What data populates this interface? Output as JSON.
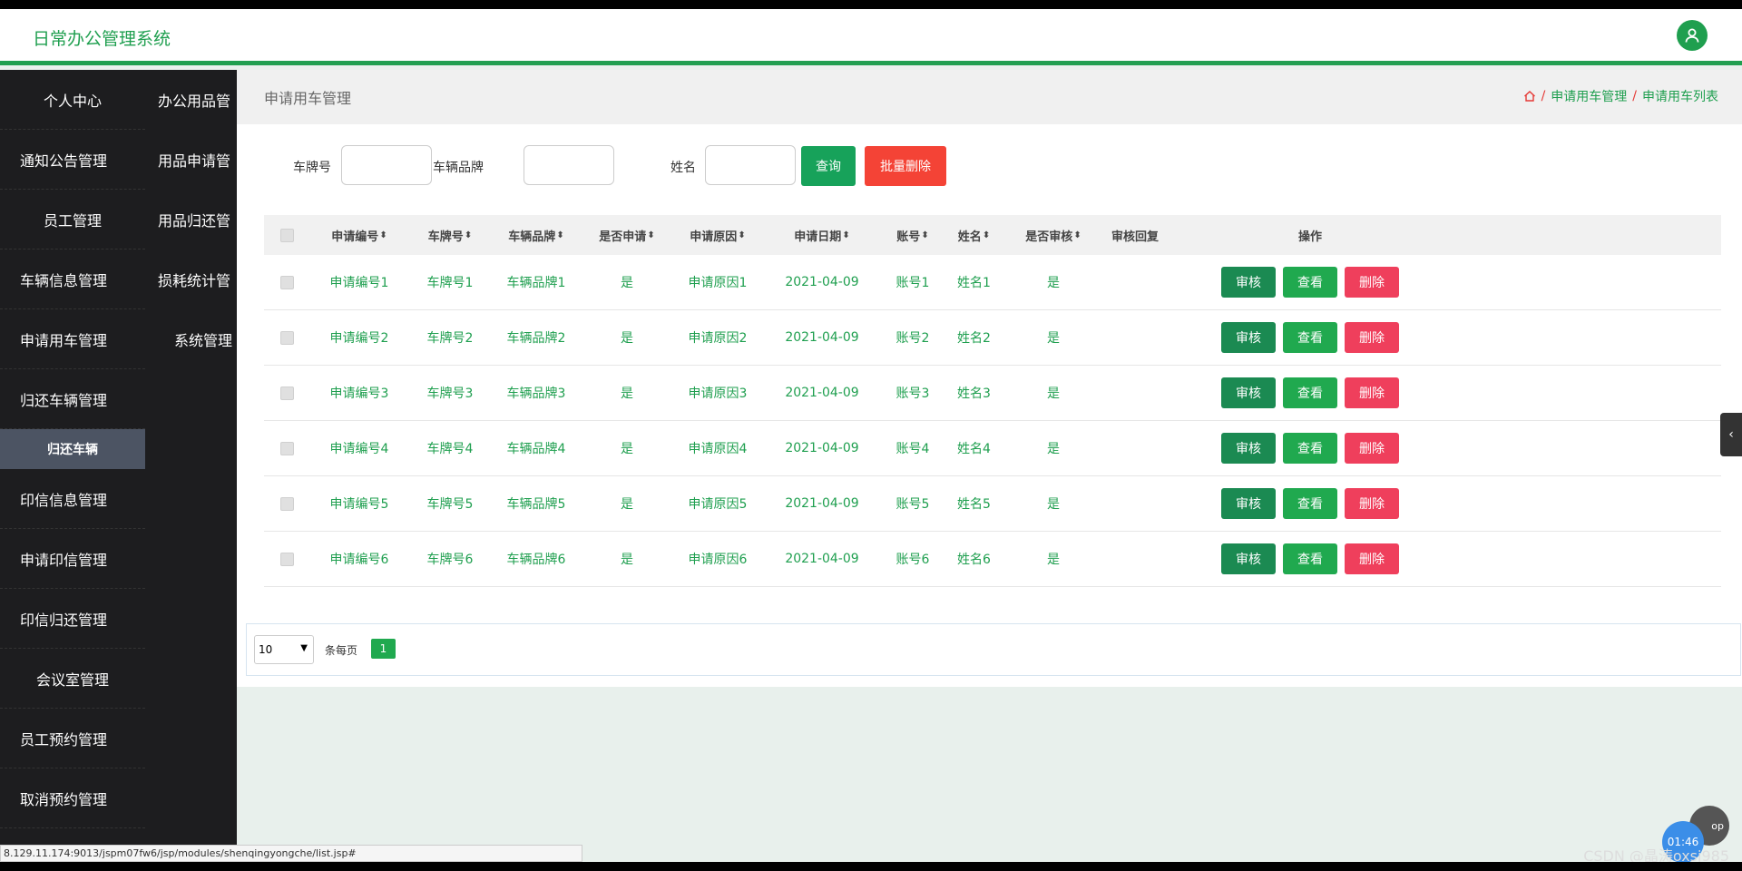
{
  "header": {
    "title": "日常办公管理系统",
    "avatar_icon": "user-icon"
  },
  "sidebar": {
    "col1": [
      "个人中心",
      "通知公告管理",
      "员工管理",
      "车辆信息管理",
      "申请用车管理",
      "归还车辆管理",
      "印信信息管理",
      "申请印信管理",
      "印信归还管理",
      "会议室管理",
      "员工预约管理",
      "取消预约管理"
    ],
    "sub_item": "归还车辆",
    "col2": [
      "办公用品管",
      "用品申请管",
      "用品归还管",
      "损耗统计管",
      "系统管理"
    ]
  },
  "content": {
    "heading": "申请用车管理",
    "breadcrumb": {
      "home_icon": "home-icon",
      "sep": "/",
      "level1": "申请用车管理",
      "level2": "申请用车列表"
    }
  },
  "search": {
    "plate_label": "车牌号",
    "brand_label": "车辆品牌",
    "name_label": "姓名",
    "query_label": "查询",
    "bulk_delete_label": "批量删除"
  },
  "table": {
    "headers": [
      "申请编号",
      "车牌号",
      "车辆品牌",
      "是否申请",
      "申请原因",
      "申请日期",
      "账号",
      "姓名",
      "是否审核",
      "审核回复",
      "操作"
    ],
    "rows": [
      [
        "申请编号1",
        "车牌号1",
        "车辆品牌1",
        "是",
        "申请原因1",
        "2021-04-09",
        "账号1",
        "姓名1",
        "是",
        ""
      ],
      [
        "申请编号2",
        "车牌号2",
        "车辆品牌2",
        "是",
        "申请原因2",
        "2021-04-09",
        "账号2",
        "姓名2",
        "是",
        ""
      ],
      [
        "申请编号3",
        "车牌号3",
        "车辆品牌3",
        "是",
        "申请原因3",
        "2021-04-09",
        "账号3",
        "姓名3",
        "是",
        ""
      ],
      [
        "申请编号4",
        "车牌号4",
        "车辆品牌4",
        "是",
        "申请原因4",
        "2021-04-09",
        "账号4",
        "姓名4",
        "是",
        ""
      ],
      [
        "申请编号5",
        "车牌号5",
        "车辆品牌5",
        "是",
        "申请原因5",
        "2021-04-09",
        "账号5",
        "姓名5",
        "是",
        ""
      ],
      [
        "申请编号6",
        "车牌号6",
        "车辆品牌6",
        "是",
        "申请原因6",
        "2021-04-09",
        "账号6",
        "姓名6",
        "是",
        ""
      ]
    ],
    "actions": {
      "audit": "审核",
      "view": "查看",
      "delete": "删除"
    }
  },
  "pager": {
    "page_size": "10",
    "per_page_label": "条每页",
    "current_page": "1"
  },
  "status_url": "8.129.11.174:9013/jspm07fw6/jsp/modules/shenqingyongche/list.jsp#",
  "overlay": {
    "top_label": "op",
    "time": "01:46",
    "watermark": "CSDN @晶涛oxsj985"
  },
  "colors": {
    "accent": "#1f9f4f",
    "danger": "#f44336",
    "sidebar": "#1d1d1f"
  }
}
